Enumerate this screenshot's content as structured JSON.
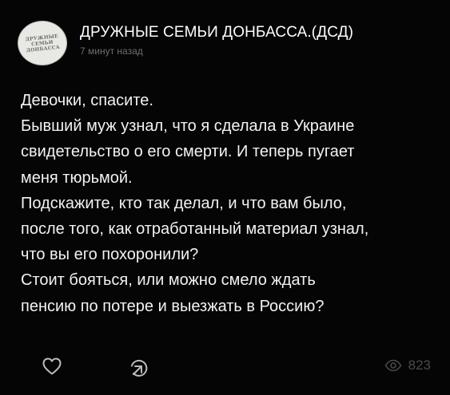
{
  "post": {
    "channel_name": "ДРУЖНЫЕ СЕМЬИ ДОНБАССА.(ДСД)",
    "time_ago": "7 минут назад",
    "avatar_text": "ДРУЖНЫЕ СЕМЬИ ДОНБАССА",
    "lines": [
      "Девочки, спасите.",
      "Бывший муж узнал, что я сделала в Украине",
      "свидетельство о его смерти. И теперь пугает",
      "меня тюрьмой.",
      "Подскажите, кто так делал, и что вам было,",
      "после того, как отработанный материал узнал,",
      "что вы его похоронили?",
      "Стоит бояться, или можно смело ждать",
      "пенсию по потере и выезжать в Россию?"
    ],
    "views_count": "823"
  },
  "icons": {
    "like": "heart-icon",
    "share": "share-icon",
    "views": "eye-icon"
  },
  "colors": {
    "background": "#050505",
    "text": "#f2f2f2",
    "muted": "#6e6e6e",
    "icon": "#bdbdbd",
    "views": "#4a4a4a"
  }
}
